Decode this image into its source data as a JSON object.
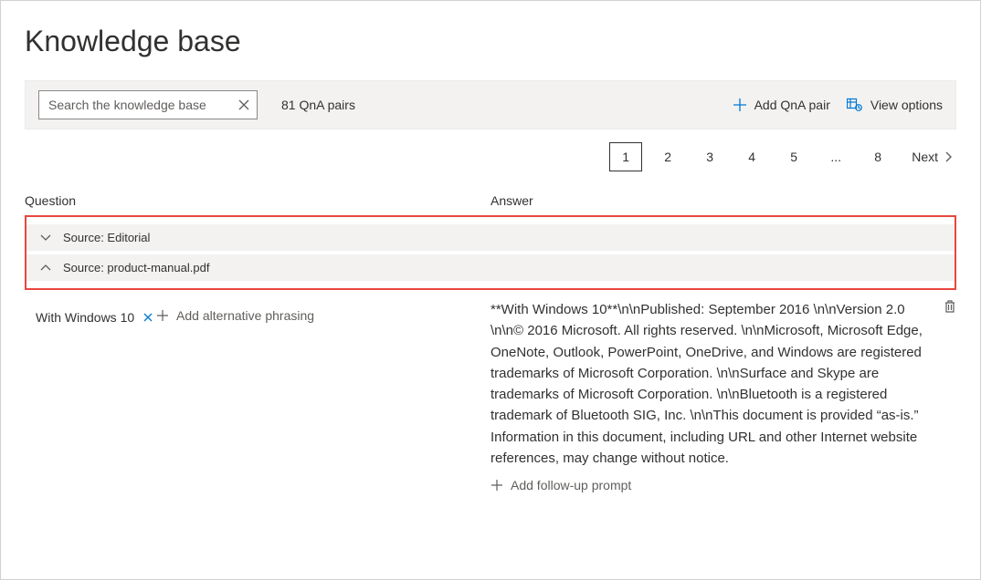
{
  "page_title": "Knowledge base",
  "toolbar": {
    "search_placeholder": "Search the knowledge base",
    "pair_count_label": "81 QnA pairs",
    "add_pair_label": "Add QnA pair",
    "view_options_label": "View options"
  },
  "pagination": {
    "pages": [
      "1",
      "2",
      "3",
      "4",
      "5",
      "...",
      "8"
    ],
    "current": "1",
    "next_label": "Next"
  },
  "columns": {
    "question": "Question",
    "answer": "Answer"
  },
  "sources": {
    "collapsed_label": "Source: Editorial",
    "expanded_label": "Source: product-manual.pdf"
  },
  "qna": {
    "question_text": "With Windows 10",
    "add_phrasing_label": "Add alternative phrasing",
    "answer_text": "**With Windows 10**\\n\\nPublished: September 2016 \\n\\nVersion 2.0 \\n\\n© 2016 Microsoft. All rights reserved. \\n\\nMicrosoft, Microsoft Edge, OneNote, Outlook, PowerPoint, OneDrive, and Windows are registered trademarks of Microsoft Corporation. \\n\\nSurface and Skype are trademarks of Microsoft Corporation. \\n\\nBluetooth is a registered trademark of Bluetooth SIG, Inc. \\n\\nThis document is provided “as-is.” Information in this document, including URL and other Internet website references, may change without notice.",
    "add_followup_label": "Add follow-up prompt"
  }
}
